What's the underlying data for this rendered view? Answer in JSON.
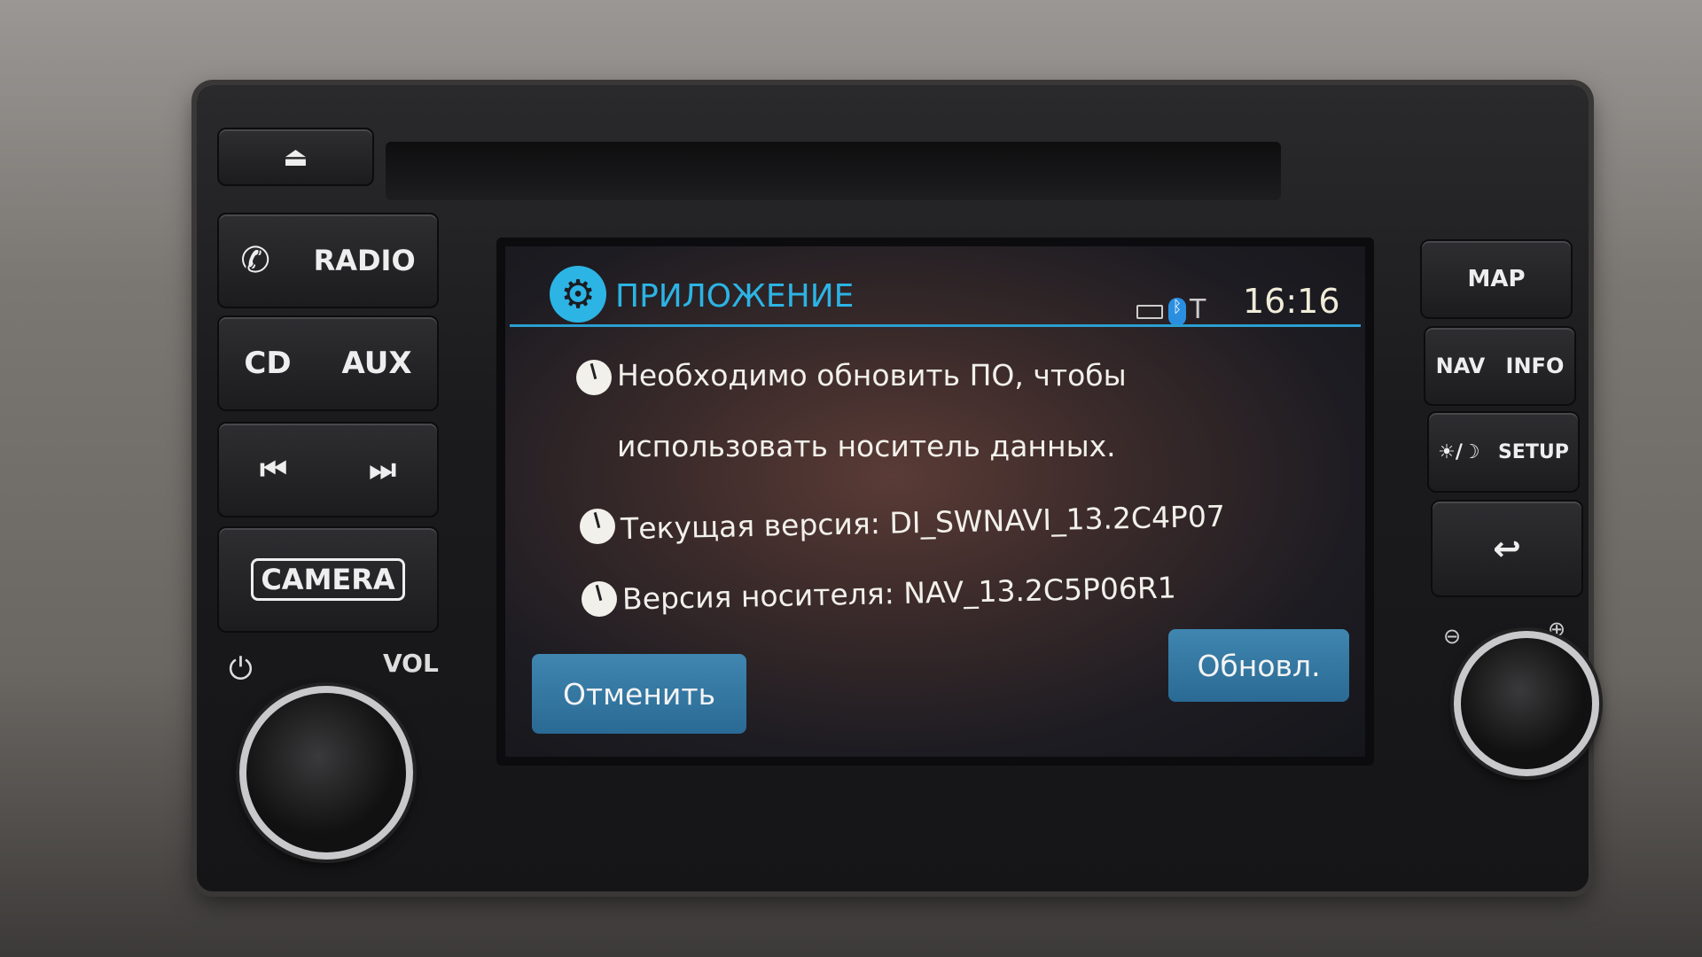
{
  "hardware": {
    "left": {
      "radio": "RADIO",
      "cd": "CD",
      "aux": "AUX",
      "camera": "CAMERA",
      "vol": "VOL"
    },
    "right": {
      "map": "MAP",
      "nav": "NAV",
      "info": "INFO",
      "setup": "SETUP"
    }
  },
  "screen": {
    "title": "ПРИЛОЖЕНИЕ",
    "time": "16:16",
    "messages": [
      "Необходимо обновить ПО, чтобы",
      "использовать носитель данных.",
      "Текущая версия: DI_SWNAVI_13.2C4P07",
      "Версия носителя: NAV_13.2C5P06R1"
    ],
    "cancel": "Отменить",
    "update": "Обновл."
  },
  "colors": {
    "accent": "#2cb4e4",
    "button": "#2f74a0"
  },
  "icons": [
    "eject-icon",
    "phone-icon",
    "prev-track-icon",
    "next-track-icon",
    "power-icon",
    "gear-icon",
    "battery-icon",
    "bluetooth-icon",
    "signal-icon",
    "clock-icon",
    "brightness-icon",
    "back-icon",
    "zoom-out-icon",
    "zoom-in-icon"
  ]
}
